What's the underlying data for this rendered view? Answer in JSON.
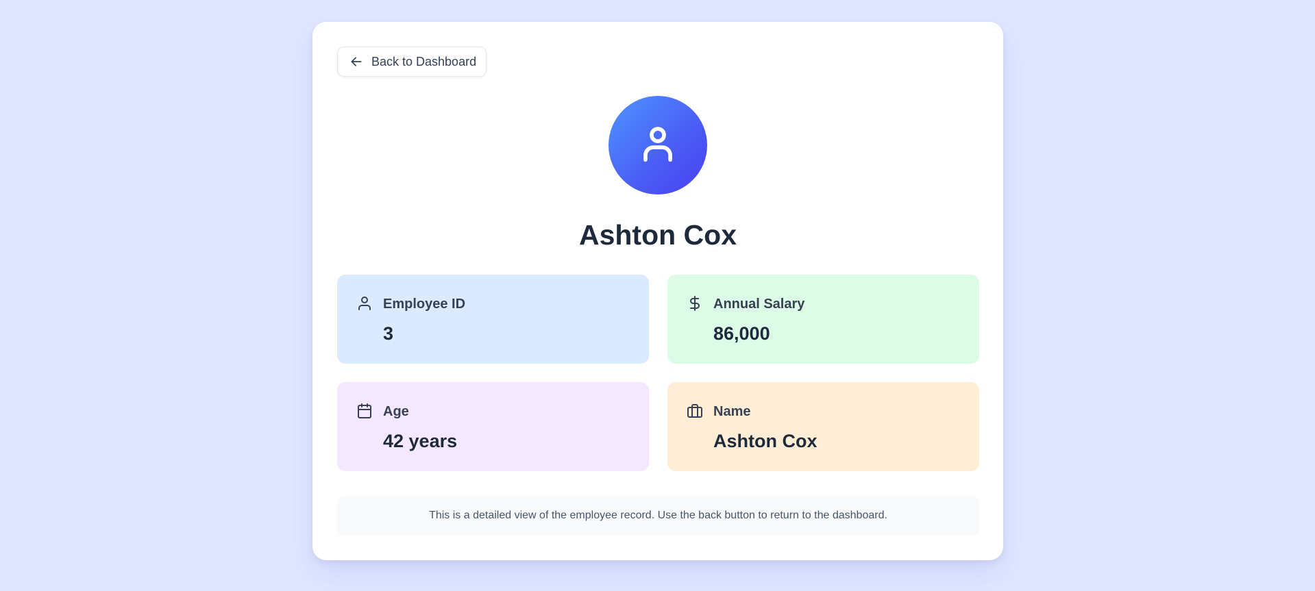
{
  "navigation": {
    "back_label": "Back to Dashboard",
    "back_icon": "arrow-left-icon"
  },
  "profile": {
    "avatar_icon": "user-icon",
    "name": "Ashton Cox"
  },
  "details": [
    {
      "icon": "user-icon",
      "label": "Employee ID",
      "value": "3",
      "background": "#dbeafe"
    },
    {
      "icon": "dollar-icon",
      "label": "Annual Salary",
      "value": "86,000",
      "background": "#dcfce7"
    },
    {
      "icon": "calendar-icon",
      "label": "Age",
      "value": "42 years",
      "background": "#f3e8ff"
    },
    {
      "icon": "briefcase-icon",
      "label": "Name",
      "value": "Ashton Cox",
      "background": "#ffedd5"
    }
  ],
  "footer_note": "This is a detailed view of the employee record. Use the back button to return to the dashboard.",
  "colors": {
    "page_background": "#e0e7ff",
    "avatar_gradient_start": "#4f95ff",
    "avatar_gradient_end": "#4b3ff0",
    "text_primary": "#1e293b"
  }
}
